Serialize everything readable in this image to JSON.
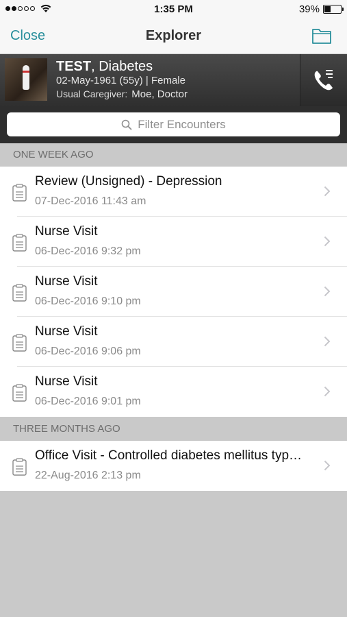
{
  "status_bar": {
    "time": "1:35 PM",
    "battery": "39%",
    "battery_level": 0.39,
    "signal_strength": 2,
    "signal_max": 5
  },
  "nav": {
    "close_label": "Close",
    "title": "Explorer",
    "folder_icon": "folder-icon"
  },
  "patient": {
    "last_name": "TEST",
    "first_name": ", Diabetes",
    "dob_line": "02-May-1961 (55y) | Female",
    "caregiver_label": "Usual Caregiver:",
    "caregiver_name": "Moe, Doctor",
    "call_icon": "phone-list-icon"
  },
  "filter": {
    "placeholder": "Filter Encounters"
  },
  "sections": [
    {
      "header": "ONE WEEK AGO",
      "encounters": [
        {
          "title": "Review (Unsigned) - Depression",
          "date": "07-Dec-2016 11:43 am"
        },
        {
          "title": "Nurse Visit",
          "date": "06-Dec-2016 9:32 pm"
        },
        {
          "title": "Nurse Visit",
          "date": "06-Dec-2016 9:10 pm"
        },
        {
          "title": "Nurse Visit",
          "date": "06-Dec-2016 9:06 pm"
        },
        {
          "title": "Nurse Visit",
          "date": "06-Dec-2016 9:01 pm"
        }
      ]
    },
    {
      "header": "THREE MONTHS AGO",
      "encounters": [
        {
          "title": "Office Visit - Controlled diabetes mellitus typ…",
          "date": "22-Aug-2016 2:13 pm"
        }
      ]
    }
  ],
  "colors": {
    "accent": "#2a8f9c",
    "banner": "#3a3a3a",
    "section_bg": "#c9c9c9"
  }
}
